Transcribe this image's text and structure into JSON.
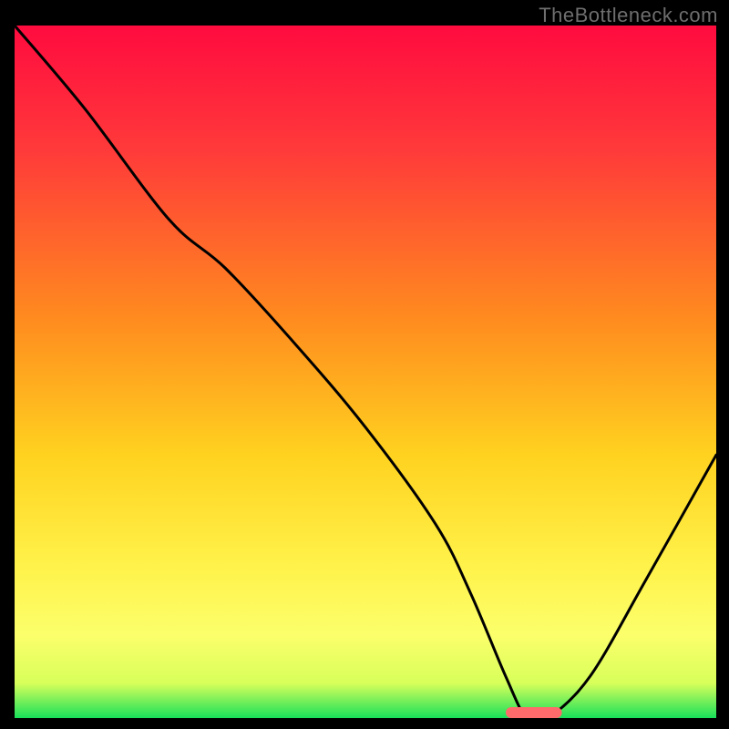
{
  "watermark": "TheBottleneck.com",
  "chart_data": {
    "type": "line",
    "title": "",
    "xlabel": "",
    "ylabel": "",
    "xlim": [
      0,
      100
    ],
    "ylim": [
      0,
      100
    ],
    "grid": false,
    "series": [
      {
        "name": "bottleneck-curve",
        "x": [
          0,
          10,
          22,
          30,
          40,
          50,
          60,
          65,
          70,
          73,
          76,
          82,
          90,
          100
        ],
        "values": [
          100,
          88,
          72,
          65,
          54,
          42,
          28,
          18,
          6,
          0,
          0,
          6,
          20,
          38
        ]
      }
    ],
    "optimal_band": {
      "x_start": 70,
      "x_end": 78,
      "y": 0
    },
    "gradient_stops": [
      {
        "pos": 0.0,
        "color": "#ff0b3f"
      },
      {
        "pos": 0.18,
        "color": "#ff3a3a"
      },
      {
        "pos": 0.42,
        "color": "#ff8a1f"
      },
      {
        "pos": 0.62,
        "color": "#ffd21f"
      },
      {
        "pos": 0.78,
        "color": "#fff24a"
      },
      {
        "pos": 0.88,
        "color": "#fcff6b"
      },
      {
        "pos": 0.95,
        "color": "#d7ff5a"
      },
      {
        "pos": 1.0,
        "color": "#18e05a"
      }
    ],
    "marker_color": "#ff6a6a",
    "line_color": "#000000"
  }
}
